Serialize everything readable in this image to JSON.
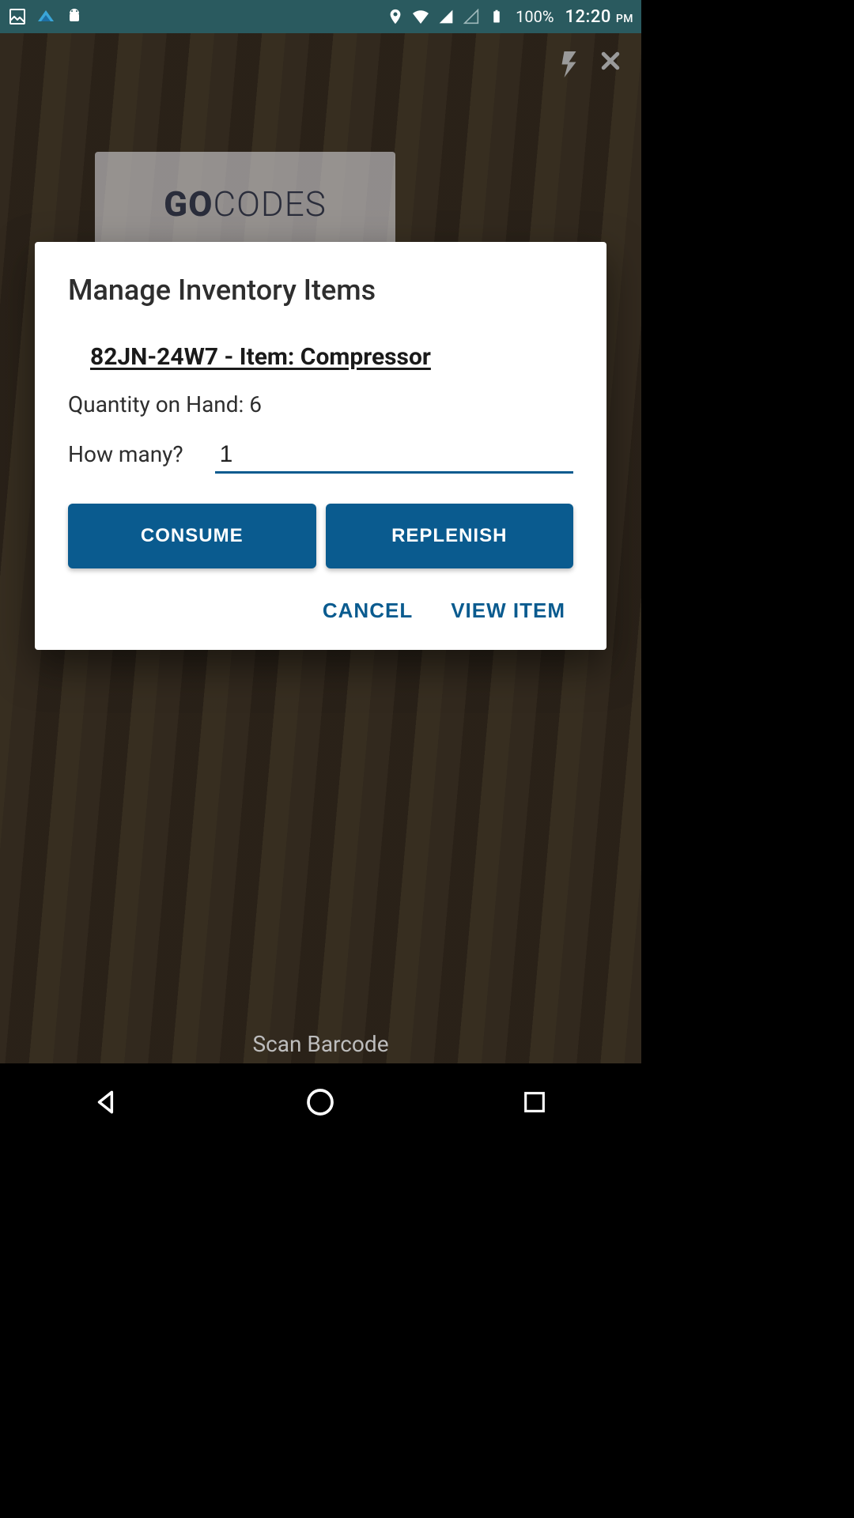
{
  "statusbar": {
    "battery_pct": "100%",
    "time": "12:20",
    "ampm": "PM"
  },
  "camera": {
    "brand_bold": "GO",
    "brand_light": "CODES",
    "scan_label": "Scan Barcode"
  },
  "dialog": {
    "title": "Manage Inventory Items",
    "item_line": "82JN-24W7 - Item: Compressor",
    "qty_line": "Quantity on Hand: 6",
    "howmany_label": "How many?",
    "qty_value": "1",
    "consume_label": "CONSUME",
    "replenish_label": "REPLENISH",
    "cancel_label": "CANCEL",
    "view_label": "VIEW ITEM"
  }
}
